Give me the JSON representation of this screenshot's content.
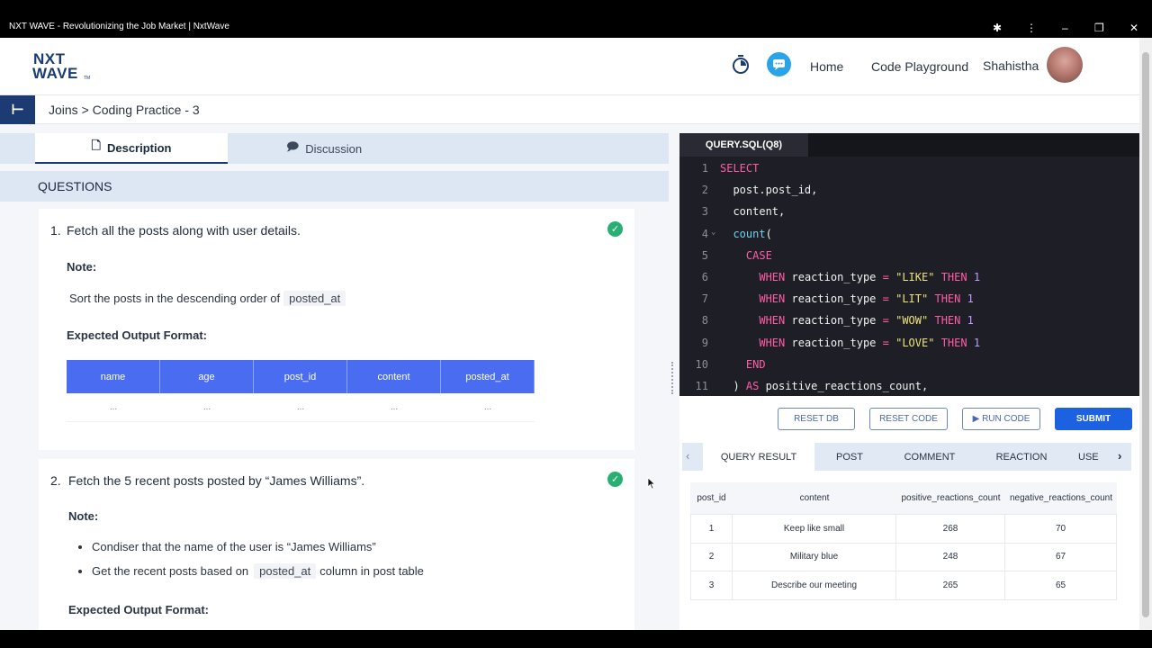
{
  "window": {
    "title": "NXT WAVE - Revolutionizing the Job Market | NxtWave"
  },
  "header": {
    "logo_line1": "NXT",
    "logo_line2": "WAVE",
    "logo_tm": "TM",
    "nav_home": "Home",
    "nav_playground": "Code Playground",
    "user_name": "Shahistha"
  },
  "breadcrumb": "Joins > Coding Practice - 3",
  "tabs": {
    "description": "Description",
    "discussion": "Discussion"
  },
  "questions_header": "QUESTIONS",
  "questions": [
    {
      "number": "1.",
      "title": "Fetch all the posts along with user details.",
      "note_label": "Note:",
      "note_text": "Sort the posts in the descending order of",
      "note_code": "posted_at",
      "output_label": "Expected Output Format:",
      "columns": [
        "name",
        "age",
        "post_id",
        "content",
        "posted_at"
      ],
      "placeholder": "..."
    },
    {
      "number": "2.",
      "title": "Fetch the 5 recent posts posted by “James Williams”.",
      "note_label": "Note:",
      "bullet1": "Condiser that the name of the user is “James Williams”",
      "bullet2_pre": "Get the recent posts based on",
      "bullet2_code": "posted_at",
      "bullet2_post": "column in post table",
      "output_label": "Expected Output Format:"
    }
  ],
  "editor": {
    "tab": "QUERY.SQL(Q8)",
    "lines": [
      "1",
      "2",
      "3",
      "4",
      "5",
      "6",
      "7",
      "8",
      "9",
      "10",
      "11"
    ]
  },
  "actions": {
    "reset_db": "RESET DB",
    "reset_code": "RESET CODE",
    "run_code": "▶ RUN CODE",
    "submit": "SUBMIT"
  },
  "result_tabs": [
    "QUERY RESULT",
    "POST",
    "COMMENT",
    "REACTION",
    "USE"
  ],
  "result_table": {
    "headers": [
      "post_id",
      "content",
      "positive_reactions_count",
      "negative_reactions_count"
    ],
    "rows": [
      [
        "1",
        "Keep like small",
        "268",
        "70"
      ],
      [
        "2",
        "Military blue",
        "248",
        "67"
      ],
      [
        "3",
        "Describe our meeting",
        "265",
        "65"
      ]
    ]
  }
}
